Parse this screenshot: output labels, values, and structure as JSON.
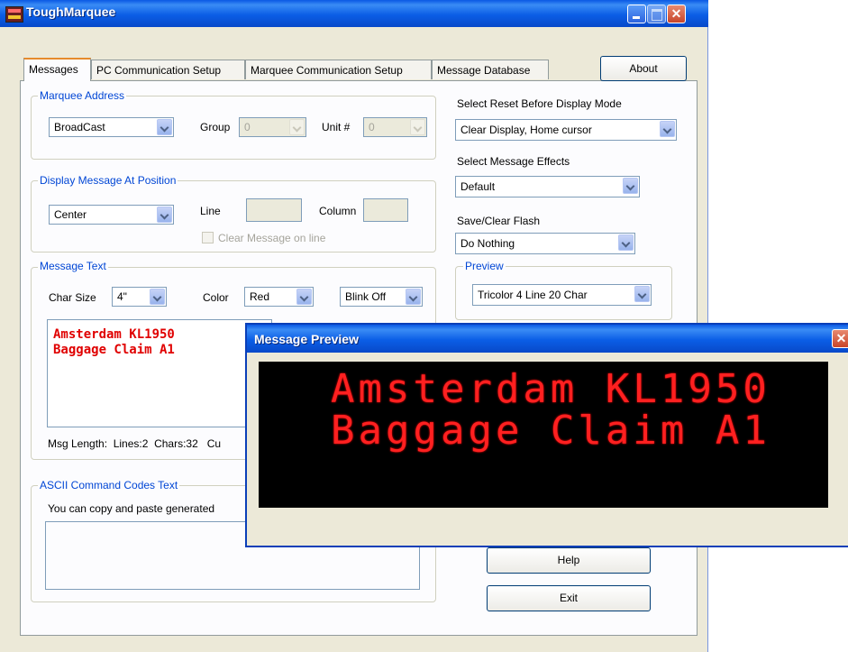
{
  "app": {
    "title": "ToughMarquee",
    "close_glyph": "✕"
  },
  "tabs": [
    "Messages",
    "PC Communication Setup",
    "Marquee Communication Setup",
    "Message Database"
  ],
  "about_label": "About",
  "marquee_address": {
    "legend": "Marquee Address",
    "address_value": "BroadCast",
    "group_label": "Group",
    "group_value": "0",
    "unit_label": "Unit #",
    "unit_value": "0"
  },
  "display_position": {
    "legend": "Display Message At Position",
    "position_value": "Center",
    "line_label": "Line",
    "column_label": "Column",
    "clear_label": "Clear Message on line"
  },
  "message_text": {
    "legend": "Message Text",
    "char_size_label": "Char Size",
    "char_size_value": "4\"",
    "color_label": "Color",
    "color_value": "Red",
    "blink_value": "Blink Off",
    "lines": [
      "Amsterdam KL1950",
      "Baggage Claim A1"
    ],
    "length_text": "Msg Length:  Lines:2  Chars:32   Cu"
  },
  "ascii": {
    "legend": "ASCII Command Codes Text",
    "hint": "You can copy and paste generated"
  },
  "reset_mode": {
    "label": "Select Reset Before Display Mode",
    "value": "Clear Display, Home cursor"
  },
  "effects": {
    "label": "Select Message Effects",
    "value": "Default"
  },
  "flash": {
    "label": "Save/Clear Flash",
    "value": "Do Nothing"
  },
  "preview_group": {
    "legend": "Preview",
    "value": "Tricolor 4 Line 20 Char"
  },
  "help_label": "Help",
  "exit_label": "Exit",
  "preview_window": {
    "title": "Message Preview",
    "close_glyph": "✕",
    "lines": [
      "Amsterdam KL1950",
      "Baggage Claim A1"
    ]
  },
  "colors": {
    "led_text": "#ff2020",
    "led_bg": "#000000",
    "titlebar": "#0b5ee6",
    "group_label": "#0046d5"
  },
  "icons": [
    "app-icon",
    "minimize-icon",
    "maximize-icon",
    "close-icon",
    "dropdown-arrow-icon"
  ]
}
